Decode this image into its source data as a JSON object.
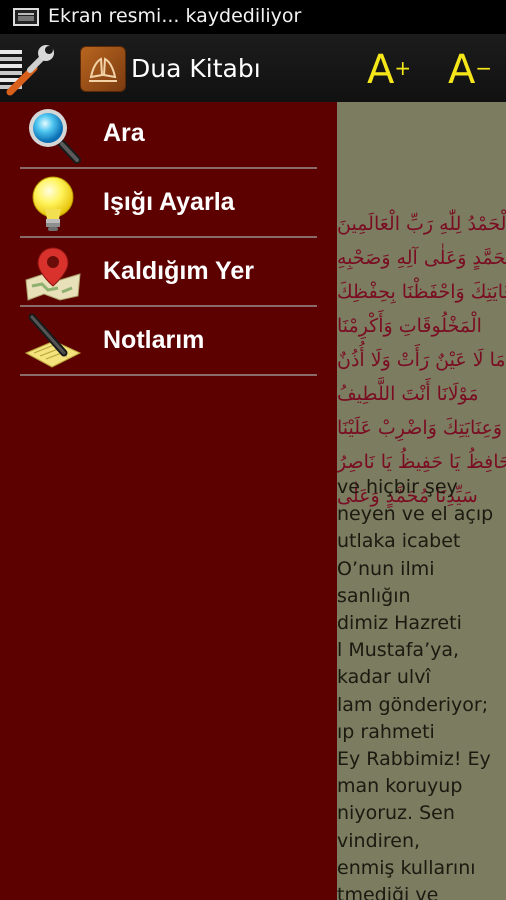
{
  "status_bar": {
    "notification_icon": "screenshot-icon",
    "text": "Ekran resmi... kaydediliyor"
  },
  "action_bar": {
    "app_title": "Dua Kitabı",
    "font_increase_label": "A",
    "font_increase_sign": "+",
    "font_decrease_label": "A",
    "font_decrease_sign": "−",
    "accent_color": "#f5e61a"
  },
  "drawer": {
    "background_color": "#5c0000",
    "items": [
      {
        "label": "Ara",
        "icon": "search-icon"
      },
      {
        "label": "Işığı Ayarla",
        "icon": "lightbulb-icon"
      },
      {
        "label": "Kaldığım Yer",
        "icon": "map-pin-icon"
      },
      {
        "label": "Notlarım",
        "icon": "notepad-pen-icon"
      }
    ]
  },
  "content": {
    "arabic_lines": [
      "اَلْحَمْدُ لِلّٰهِ رَبِّ الْعَالَمِينَ",
      "مُحَمَّدٍ وَعَلٰى آلِهِ وَصَحْبِهِ",
      "بِرِعَايَتِكَ وَاحْفَظْنَا بِحِفْظِكَ",
      "الْمَخْلُوقَاتِ وَأَكْرِمْنَا",
      "مَا لَا عَيْنٌ رَأَتْ وَلَا أُذُنٌ",
      "مَوْلَانَا أَنْتَ اللَّطِيفُ",
      "وَعِنَايَتِكَ وَاضْرِبْ عَلَيْنَا",
      "حَافِظُ يَا حَفِيظُ يَا نَاصِرُ",
      "سَيِّدِنَا مُحَمَّدٍ وَعَلٰى"
    ],
    "turkish_lines": [
      "ve hiçbir şey",
      "neyen ve el açıp",
      "utlaka icabet",
      "O’nun ilmi",
      "sanlığın",
      "dimiz Hazreti",
      "l Mustafa’ya,",
      "kadar ulvî",
      "lam gönderiyor;",
      "ıp rahmeti",
      "Ey Rabbimiz! Ey",
      "man koruyup",
      "niyoruz. Sen",
      "vindiren,",
      "enmiş kullarını",
      "tmediği ve"
    ]
  }
}
